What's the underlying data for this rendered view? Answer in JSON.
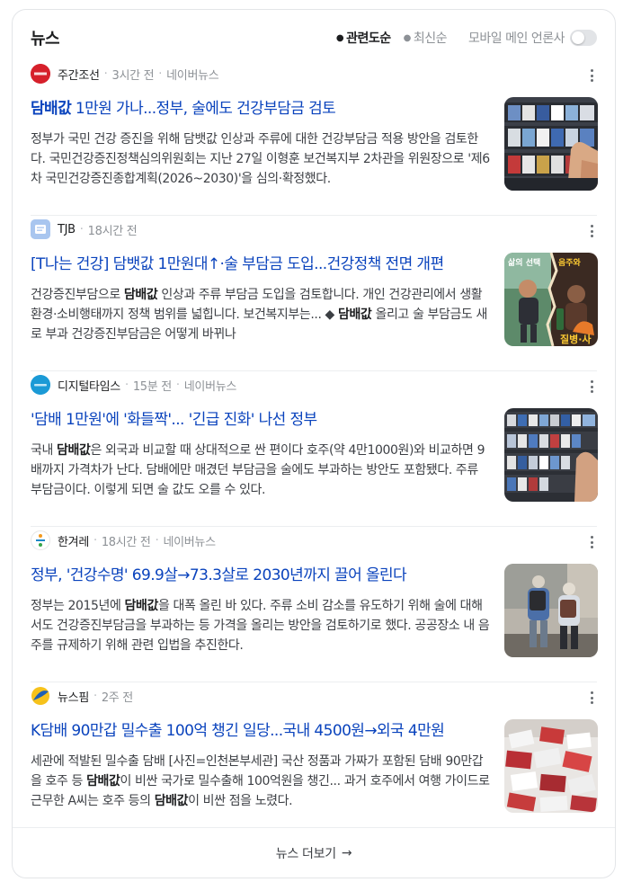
{
  "section": {
    "title": "뉴스",
    "sort_options": [
      "관련도순",
      "최신순"
    ],
    "active_sort": "관련도순",
    "mobile_main_label": "모바일 메인 언론사",
    "mobile_main_toggle": "off"
  },
  "news": [
    {
      "source": "주간조선",
      "logo_text": "주간조선",
      "logo_color": "#d6202b",
      "time": "3시간 전",
      "portal": "네이버뉴스",
      "title_highlight": "담배값",
      "title_rest": " 1만원 가나...정부, 술에도 건강부담금 검토",
      "snippet": "정부가 국민 건강 증진을 위해 담뱃값 인상과 주류에 대한 건강부담금 적용 방안을 검토한다. 국민건강증진정책심의위원회는 지난 27일 이형훈 보건복지부 2차관을 위원장으로 '제6차 국민건강증진종합계획(2026~2030)'을 심의·확정했다."
    },
    {
      "source": "TJB",
      "logo_text": "",
      "logo_color": "#a9c6ef",
      "time": "18시간 전",
      "portal": "",
      "title_highlight": "",
      "title_rest": "[T나는 건강] 담뱃값 1만원대↑·술 부담금 도입...건강정책 전면 개편",
      "snippet_a": "건강증진부담으로 ",
      "snippet_b": "담배값",
      "snippet_c": " 인상과 주류 부담금 도입을 검토합니다. 개인 건강관리에서 생활환경·소비행태까지 정책 범위를 넓힙니다. 보건복지부는... ◆ ",
      "snippet_d": "담배값",
      "snippet_e": " 올리고 술 부담금도 새로 부과 건강증진부담금은 어떻게 바뀌나"
    },
    {
      "source": "디지털타임스",
      "logo_text": "",
      "logo_color": "#1b9ad6",
      "time": "15분 전",
      "portal": "네이버뉴스",
      "title_highlight": "",
      "title_rest": "'담배 1만원'에 '화들짝'... '긴급 진화' 나선 정부",
      "snippet_a": "국내 ",
      "snippet_b": "담배값",
      "snippet_c": "은 외국과 비교할 때 상대적으로 싼 편이다 호주(약 4만1000원)와 비교하면 9배까지 가격차가 난다. 담배에만 매겼던 부담금을 술에도 부과하는 방안도 포함됐다. 주류 부담금이다. 이렇게 되면 술 값도 오를 수 있다."
    },
    {
      "source": "한겨레",
      "logo_text": "",
      "logo_color": "#ffffff",
      "time": "18시간 전",
      "portal": "네이버뉴스",
      "title_highlight": "",
      "title_rest": "정부, '건강수명' 69.9살→73.3살로 2030년까지 끌어 올린다",
      "snippet_a": "정부는 2015년에 ",
      "snippet_b": "담배값",
      "snippet_c": "을 대폭 올린 바 있다. 주류 소비 감소를 유도하기 위해 술에 대해서도 건강증진부담금을 부과하는 등 가격을 올리는 방안을 검토하기로 했다. 공공장소 내 음주를 규제하기 위해 관련 입법을 추진한다."
    },
    {
      "source": "뉴스핌",
      "logo_text": "",
      "logo_color": "#ffffff",
      "time": "2주 전",
      "portal": "",
      "title_highlight": "",
      "title_rest": "K담배 90만갑 밀수출 100억 챙긴 일당...국내 4500원→외국 4만원",
      "snippet_a": "세관에 적발된 밀수출 담배 [사진=인천본부세관] 국산 정품과 가짜가 포함된 담배 90만갑을 호주 등 ",
      "snippet_b": "담배값",
      "snippet_c": "이 비싼 국가로 밀수출해 100억원을 챙긴... 과거 호주에서 여행 가이드로 근무한 A씨는 호주 등의 ",
      "snippet_d": "담배값",
      "snippet_e": "이 비싼 점을 노렸다."
    }
  ],
  "footer": {
    "label": "뉴스 더보기",
    "arrow": "→"
  }
}
